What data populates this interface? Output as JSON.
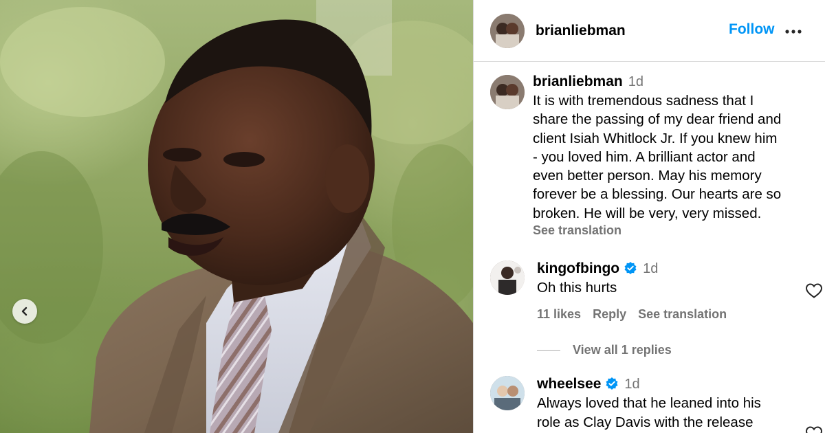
{
  "post": {
    "username": "brianliebman",
    "follow_label": "Follow",
    "more_icon": "more-horizontal-icon",
    "prev_icon": "chevron-left-icon"
  },
  "caption": {
    "username": "brianliebman",
    "time": "1d",
    "text": "It is with tremendous sadness that I\nshare the passing of my dear friend and\nclient Isiah Whitlock Jr.  If you knew him\n- you loved him.  A brilliant actor and\neven better person.  May his memory\nforever be a blessing.  Our hearts are so\nbroken.  He will be very, very missed.",
    "see_translation": "See translation"
  },
  "comments": [
    {
      "username": "kingofbingo",
      "verified": true,
      "time": "1d",
      "text": "Oh this hurts",
      "likes": "11 likes",
      "reply": "Reply",
      "see_translation": "See translation",
      "view_replies": "View all 1 replies"
    },
    {
      "username": "wheelsee",
      "verified": true,
      "time": "1d",
      "text": "Always loved that he leaned into his\nrole as Clay Davis with the release"
    }
  ],
  "colors": {
    "accent": "#0095f6",
    "muted": "#737373",
    "verified": "#0095f6",
    "divider": "#dbdbdb"
  }
}
